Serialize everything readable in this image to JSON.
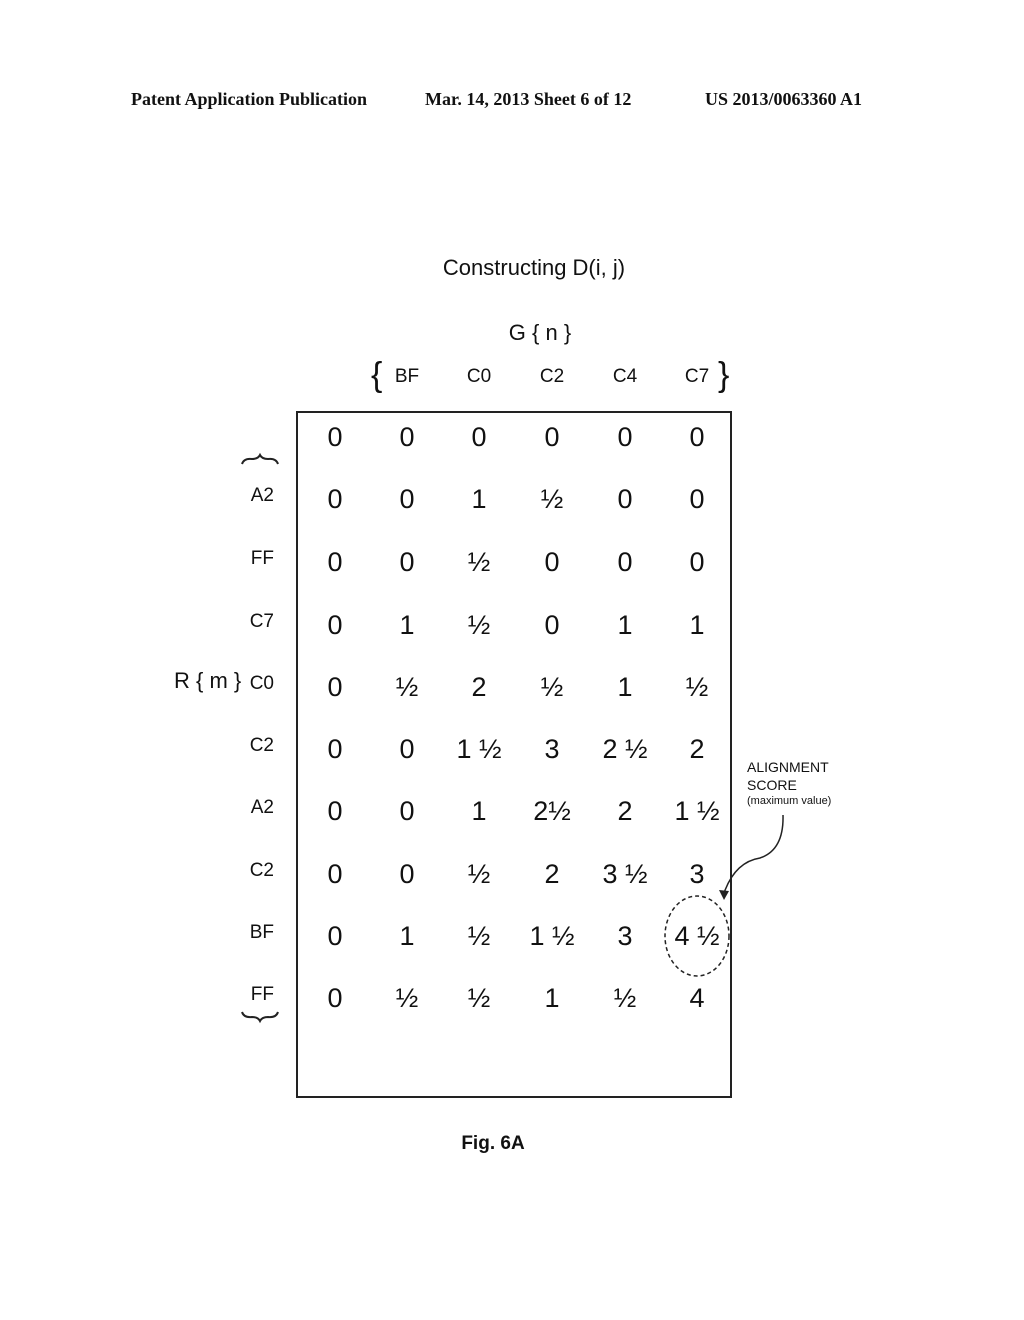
{
  "header": {
    "left": "Patent Application Publication",
    "middle": "Mar. 14, 2013  Sheet 6 of 12",
    "right": "US 2013/0063360 A1"
  },
  "figure": {
    "title": "Constructing D(i, j)",
    "g_label": "G { n }",
    "r_label": "R { m }",
    "open_brace": "{",
    "close_brace": "}",
    "column_headers": [
      "BF",
      "C0",
      "C2",
      "C4",
      "C7"
    ],
    "row_labels": [
      "",
      "A2",
      "FF",
      "C7",
      "C0",
      "C2",
      "A2",
      "C2",
      "BF",
      "FF"
    ],
    "matrix": [
      [
        "0",
        "0",
        "0",
        "0",
        "0",
        "0"
      ],
      [
        "0",
        "0",
        "1",
        "½",
        "0",
        "0"
      ],
      [
        "0",
        "0",
        "½",
        "0",
        "0",
        "0"
      ],
      [
        "0",
        "1",
        "½",
        "0",
        "1",
        "1"
      ],
      [
        "0",
        "½",
        "2",
        "½",
        "1",
        "½"
      ],
      [
        "0",
        "0",
        "1 ½",
        "3",
        "2 ½",
        "2"
      ],
      [
        "0",
        "0",
        "1",
        "2½",
        "2",
        "1 ½"
      ],
      [
        "0",
        "0",
        "½",
        "2",
        "3 ½",
        "3"
      ],
      [
        "0",
        "1",
        "½",
        "1 ½",
        "3",
        "4 ½"
      ],
      [
        "0",
        "½",
        "½",
        "1",
        "½",
        "4"
      ]
    ],
    "annotation": {
      "line1": "ALIGNMENT",
      "line2": "SCORE",
      "line3": "(maximum value)"
    },
    "highlighted_cell": {
      "row": 8,
      "col": 5,
      "value": "4 ½"
    },
    "caption": "Fig. 6A"
  }
}
